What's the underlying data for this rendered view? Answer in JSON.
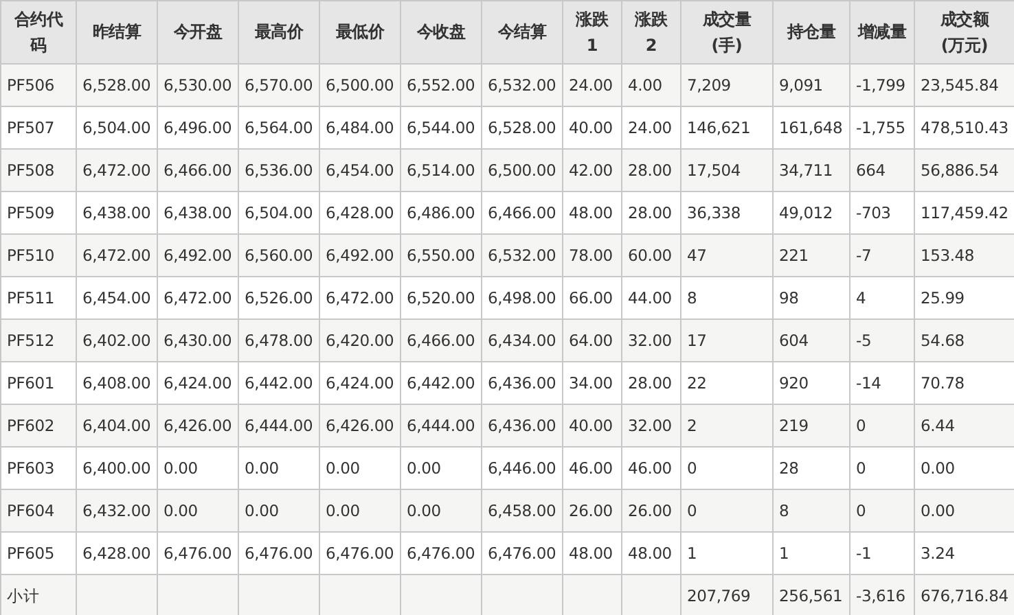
{
  "table": {
    "columns": [
      "合约代码",
      "昨结算",
      "今开盘",
      "最高价",
      "最低价",
      "今收盘",
      "今结算",
      "涨跌1",
      "涨跌2",
      "成交量(手)",
      "持仓量",
      "增减量",
      "成交额(万元)"
    ],
    "rows": [
      [
        "PF506",
        "6,528.00",
        "6,530.00",
        "6,570.00",
        "6,500.00",
        "6,552.00",
        "6,532.00",
        "24.00",
        "4.00",
        "7,209",
        "9,091",
        "-1,799",
        "23,545.84"
      ],
      [
        "PF507",
        "6,504.00",
        "6,496.00",
        "6,564.00",
        "6,484.00",
        "6,544.00",
        "6,528.00",
        "40.00",
        "24.00",
        "146,621",
        "161,648",
        "-1,755",
        "478,510.43"
      ],
      [
        "PF508",
        "6,472.00",
        "6,466.00",
        "6,536.00",
        "6,454.00",
        "6,514.00",
        "6,500.00",
        "42.00",
        "28.00",
        "17,504",
        "34,711",
        "664",
        "56,886.54"
      ],
      [
        "PF509",
        "6,438.00",
        "6,438.00",
        "6,504.00",
        "6,428.00",
        "6,486.00",
        "6,466.00",
        "48.00",
        "28.00",
        "36,338",
        "49,012",
        "-703",
        "117,459.42"
      ],
      [
        "PF510",
        "6,472.00",
        "6,492.00",
        "6,560.00",
        "6,492.00",
        "6,550.00",
        "6,532.00",
        "78.00",
        "60.00",
        "47",
        "221",
        "-7",
        "153.48"
      ],
      [
        "PF511",
        "6,454.00",
        "6,472.00",
        "6,526.00",
        "6,472.00",
        "6,520.00",
        "6,498.00",
        "66.00",
        "44.00",
        "8",
        "98",
        "4",
        "25.99"
      ],
      [
        "PF512",
        "6,402.00",
        "6,430.00",
        "6,478.00",
        "6,420.00",
        "6,466.00",
        "6,434.00",
        "64.00",
        "32.00",
        "17",
        "604",
        "-5",
        "54.68"
      ],
      [
        "PF601",
        "6,408.00",
        "6,424.00",
        "6,442.00",
        "6,424.00",
        "6,442.00",
        "6,436.00",
        "34.00",
        "28.00",
        "22",
        "920",
        "-14",
        "70.78"
      ],
      [
        "PF602",
        "6,404.00",
        "6,426.00",
        "6,444.00",
        "6,426.00",
        "6,444.00",
        "6,436.00",
        "40.00",
        "32.00",
        "2",
        "219",
        "0",
        "6.44"
      ],
      [
        "PF603",
        "6,400.00",
        "0.00",
        "0.00",
        "0.00",
        "0.00",
        "6,446.00",
        "46.00",
        "46.00",
        "0",
        "28",
        "0",
        "0.00"
      ],
      [
        "PF604",
        "6,432.00",
        "0.00",
        "0.00",
        "0.00",
        "0.00",
        "6,458.00",
        "26.00",
        "26.00",
        "0",
        "8",
        "0",
        "0.00"
      ],
      [
        "PF605",
        "6,428.00",
        "6,476.00",
        "6,476.00",
        "6,476.00",
        "6,476.00",
        "6,476.00",
        "48.00",
        "48.00",
        "1",
        "1",
        "-1",
        "3.24"
      ],
      [
        "小计",
        null,
        null,
        null,
        null,
        null,
        null,
        null,
        null,
        "207,769",
        "256,561",
        "-3,616",
        "676,716.84"
      ]
    ]
  }
}
